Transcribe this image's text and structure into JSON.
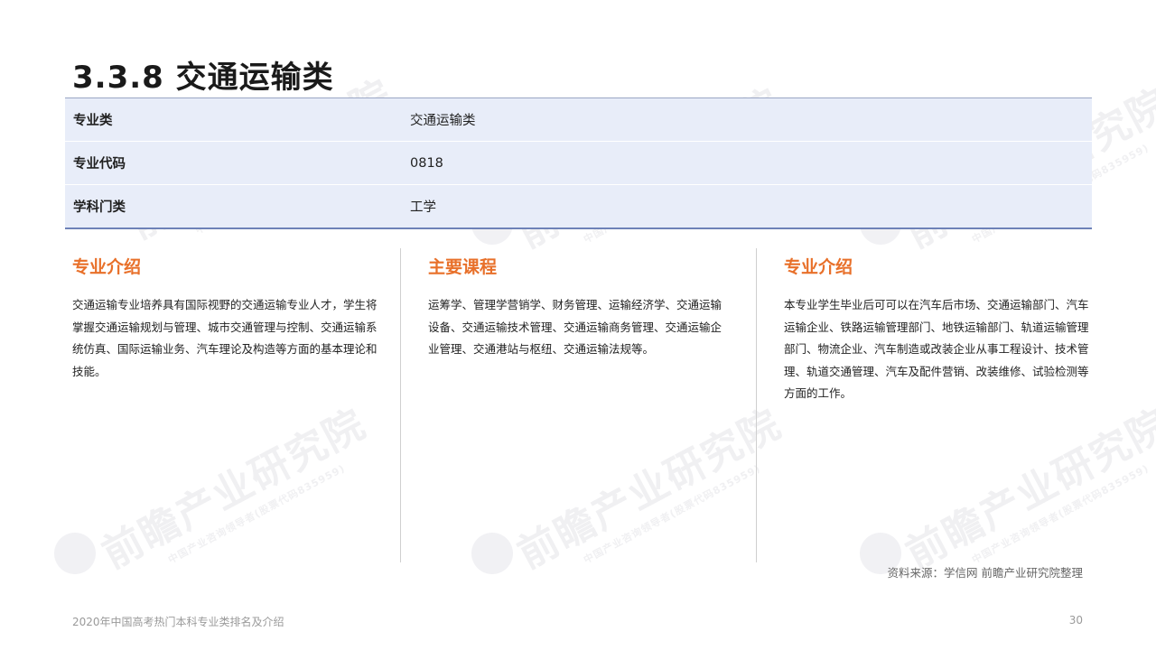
{
  "title": "3.3.8 交通运输类",
  "info_table": [
    {
      "key": "专业类",
      "value": "交通运输类"
    },
    {
      "key": "专业代码",
      "value": "0818"
    },
    {
      "key": "学科门类",
      "value": "工学"
    }
  ],
  "columns": [
    {
      "heading": "专业介绍",
      "text": "交通运输专业培养具有国际视野的交通运输专业人才，学生将掌握交通运输规划与管理、城市交通管理与控制、交通运输系统仿真、国际运输业务、汽车理论及构造等方面的基本理论和技能。"
    },
    {
      "heading": "主要课程",
      "text": "运筹学、管理学营销学、财务管理、运输经济学、交通运输设备、交通运输技术管理、交通运输商务管理、交通运输企业管理、交通港站与枢纽、交通运输法规等。"
    },
    {
      "heading": "专业介绍",
      "text": "本专业学生毕业后可可以在汽车后市场、交通运输部门、汽车运输企业、铁路运输管理部门、地铁运输部门、轨道运输管理部门、物流企业、汽车制造或改装企业从事工程设计、技术管理、轨道交通管理、汽车及配件营销、改装维修、试验检测等方面的工作。"
    }
  ],
  "source": "资料来源：学信网 前瞻产业研究院整理",
  "footer": {
    "left": "2020年中国高考热门本科专业类排名及介绍",
    "page": "30"
  },
  "watermark": {
    "main": "前瞻产业研究院",
    "sub": "中国产业咨询领导者(股票代码835959)"
  },
  "colors": {
    "accent": "#e8702a",
    "table_bg": "#e8edf9",
    "table_border": "#6e82b8"
  }
}
